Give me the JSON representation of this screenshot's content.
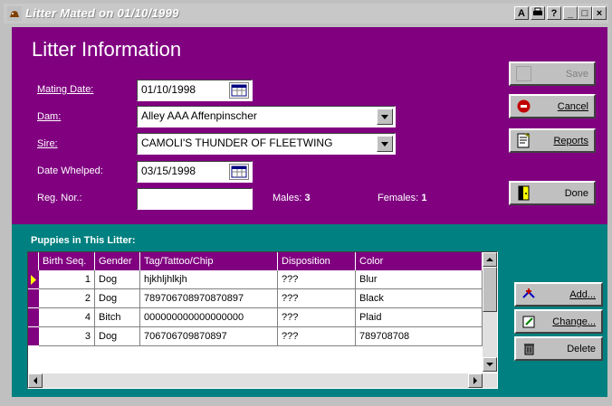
{
  "window": {
    "title": "Litter Mated on 01/10/1999",
    "controls": [
      "A",
      "?",
      "_",
      "□",
      "×"
    ]
  },
  "form": {
    "heading": "Litter Information",
    "mating_date_label": "Mating Date:",
    "mating_date_value": "01/10/1998",
    "dam_label": "Dam:",
    "dam_value": "Alley AAA Affenpinscher",
    "sire_label": "Sire:",
    "sire_value": "CAMOLI'S THUNDER OF FLEETWING",
    "date_whelped_label": "Date Whelped:",
    "date_whelped_value": "03/15/1998",
    "reg_nor_label": "Reg. Nor.:",
    "reg_nor_value": "",
    "males_label": "Males:",
    "males_value": "3",
    "females_label": "Females:",
    "females_value": "1"
  },
  "buttons": {
    "save": "Save",
    "cancel": "Cancel",
    "reports": "Reports",
    "done": "Done",
    "add": "Add...",
    "change": "Change...",
    "delete": "Delete"
  },
  "puppies": {
    "heading": "Puppies in This Litter:",
    "columns": [
      "Birth Seq.",
      "Gender",
      "Tag/Tattoo/Chip",
      "Disposition",
      "Color"
    ],
    "rows": [
      {
        "seq": "1",
        "gender": "Dog",
        "tag": "hjkhljhlkjh",
        "disposition": "???",
        "color": "Blur"
      },
      {
        "seq": "2",
        "gender": "Dog",
        "tag": "789706708970870897",
        "disposition": "???",
        "color": "Black"
      },
      {
        "seq": "4",
        "gender": "Bitch",
        "tag": "000000000000000000",
        "disposition": "???",
        "color": "Plaid"
      },
      {
        "seq": "3",
        "gender": "Dog",
        "tag": "706706709870897",
        "disposition": "???",
        "color": "789708708"
      }
    ]
  },
  "colors": {
    "form_bg": "#800080",
    "grid_area_bg": "#008080",
    "grid_header_bg": "#800080"
  }
}
